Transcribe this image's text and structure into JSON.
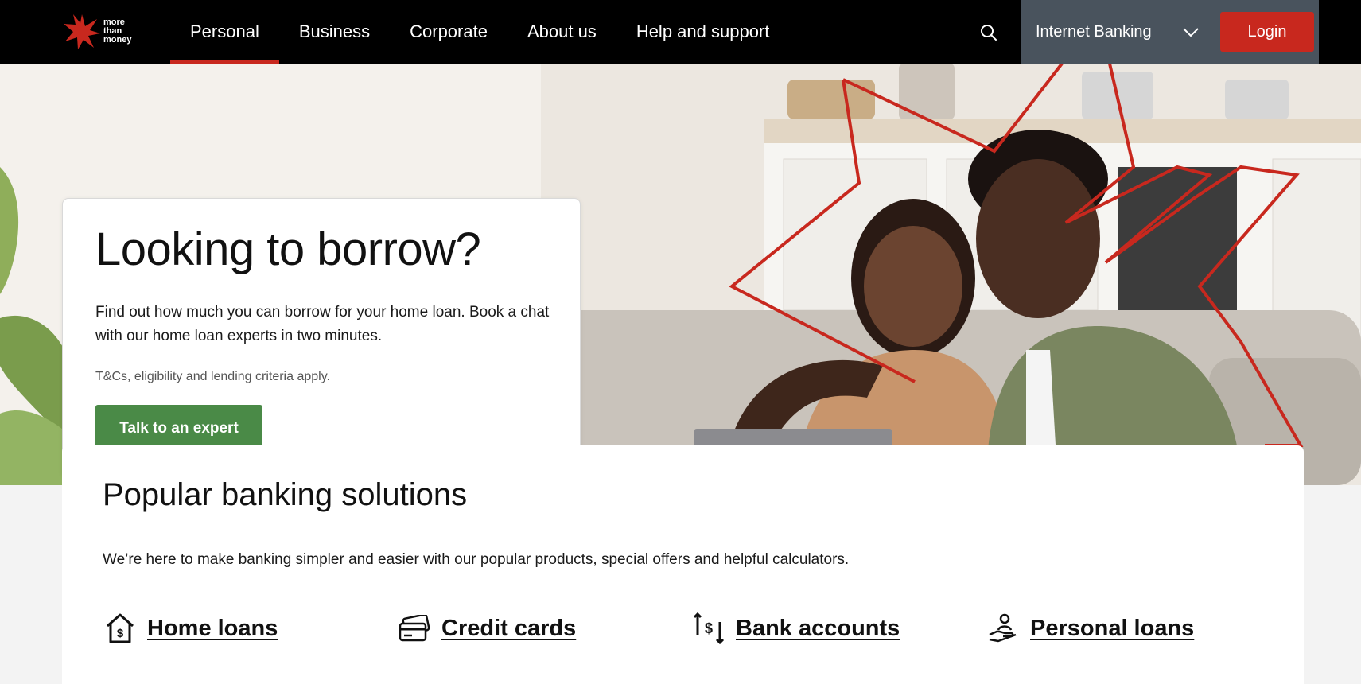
{
  "logo": {
    "line1": "more",
    "line2": "than",
    "line3": "money"
  },
  "nav": {
    "items": [
      {
        "label": "Personal",
        "active": true
      },
      {
        "label": "Business",
        "active": false
      },
      {
        "label": "Corporate",
        "active": false
      },
      {
        "label": "About us",
        "active": false
      },
      {
        "label": "Help and support",
        "active": false
      }
    ],
    "search_icon": "search-icon",
    "banking_select": "Internet Banking",
    "login_label": "Login"
  },
  "hero": {
    "title": "Looking to borrow?",
    "description": "Find out how much you can borrow for your home loan. Book a chat with our home loan experts in two minutes.",
    "note": "T&Cs, eligibility and lending criteria apply.",
    "cta_label": "Talk to an expert"
  },
  "solutions": {
    "title": "Popular banking solutions",
    "description": "We’re here to make banking simpler and easier with our popular products, special offers and helpful calculators.",
    "products": [
      {
        "label": "Home loans",
        "icon": "house-dollar-icon"
      },
      {
        "label": "Credit cards",
        "icon": "credit-card-icon"
      },
      {
        "label": "Bank accounts",
        "icon": "transfer-dollar-icon"
      },
      {
        "label": "Personal loans",
        "icon": "person-hand-icon"
      }
    ]
  },
  "colors": {
    "brand_red": "#c8281e",
    "cta_green": "#4a8a47",
    "nav_bg": "#000000",
    "banking_panel": "#49535d"
  }
}
